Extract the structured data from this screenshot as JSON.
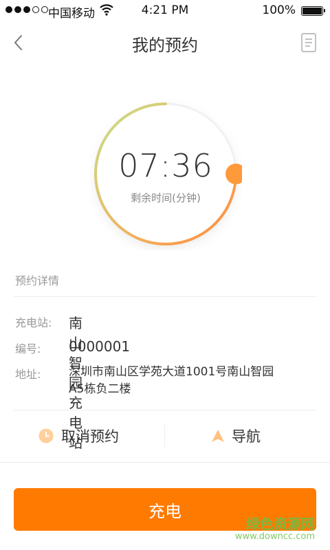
{
  "status_bar": {
    "carrier": "中国移动",
    "time": "4:21 PM",
    "battery": "100%"
  },
  "nav": {
    "title": "我的预约"
  },
  "timer": {
    "time": "07:36",
    "caption": "剩余时间(分钟)",
    "progress": 0.75,
    "colors": [
      "#c6e08a",
      "#f0b25e",
      "#ff8a3d"
    ]
  },
  "details": {
    "section_title": "预约详情",
    "station_label": "充电站:",
    "station_value": "南山智园充电站",
    "number_label": "编号:",
    "number_value": "0000001",
    "address_label": "地址:",
    "address_line1": "深圳市南山区学苑大道1001号南山智园",
    "address_line2": "A5栋负二楼"
  },
  "actions": {
    "cancel_label": "取消预约",
    "navigate_label": "导航"
  },
  "primary_button": {
    "label": "充电",
    "color": "#ff7a00"
  },
  "watermark": {
    "text": "绿色资源网",
    "url": "www.downcc.com"
  }
}
